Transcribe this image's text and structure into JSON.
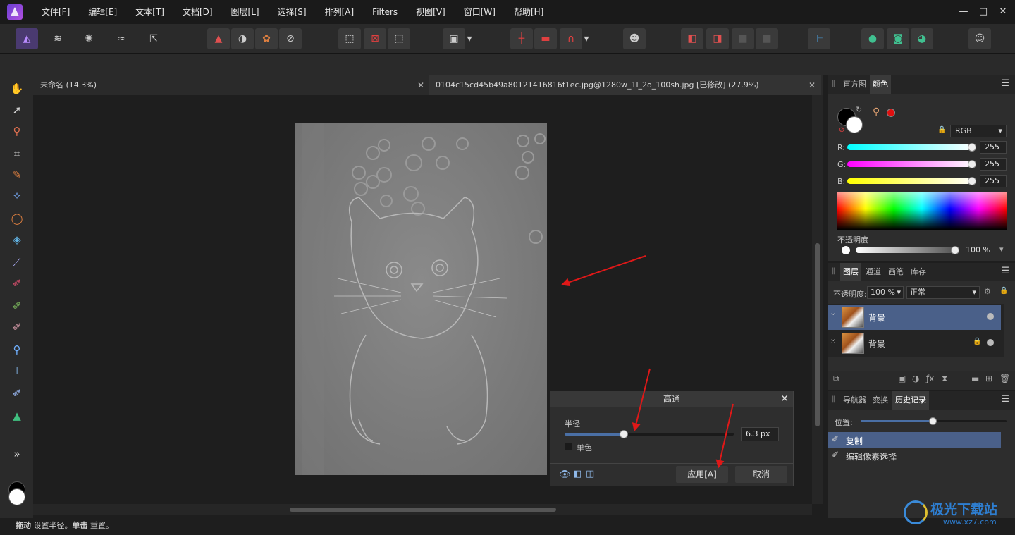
{
  "menu": [
    "文件[F]",
    "编辑[E]",
    "文本[T]",
    "文档[D]",
    "图层[L]",
    "选择[S]",
    "排列[A]",
    "Filters",
    "视图[V]",
    "窗口[W]",
    "帮助[H]"
  ],
  "window_controls": {
    "minimize": "—",
    "maximize": "□",
    "close": "✕"
  },
  "tabs": [
    {
      "label": "未命名 (14.3%)"
    },
    {
      "label": "0104c15cd45b49a80121416816f1ec.jpg@1280w_1l_2o_100sh.jpg [已修改] (27.9%)"
    }
  ],
  "dialog": {
    "title": "高通",
    "radius_label": "半径",
    "radius_value": "6.3 px",
    "radius_fraction": 0.35,
    "mono_label": "单色",
    "apply": "应用[A]",
    "cancel": "取消"
  },
  "color_panel": {
    "tabs": [
      "直方图",
      "颜色"
    ],
    "model": "RGB",
    "r_label": "R:",
    "r_value": "255",
    "g_label": "G:",
    "g_value": "255",
    "b_label": "B:",
    "b_value": "255",
    "opacity_label": "不透明度",
    "opacity_value": "100 %"
  },
  "layers_panel": {
    "tabs": [
      "图层",
      "通道",
      "画笔",
      "库存"
    ],
    "opacity_label": "不透明度:",
    "opacity_value": "100 %",
    "blend_mode": "正常",
    "layers": [
      {
        "name": "背景",
        "selected": true,
        "locked": false
      },
      {
        "name": "背景",
        "selected": false,
        "locked": true
      }
    ]
  },
  "history_panel": {
    "tabs": [
      "导航器",
      "变换",
      "历史记录"
    ],
    "position_label": "位置:",
    "items": [
      {
        "label": "复制",
        "selected": true
      },
      {
        "label": "编辑像素选择",
        "selected": false
      }
    ]
  },
  "status": {
    "bold1": "拖动",
    "text1": " 设置半径。",
    "bold2": "单击",
    "text2": " 重置。"
  },
  "watermark": {
    "text": "极光下载站",
    "url": "www.xz7.com"
  },
  "colors": {
    "accent": "#4a6fa5",
    "selected_row": "#4a6089",
    "arrow": "#e01818"
  }
}
